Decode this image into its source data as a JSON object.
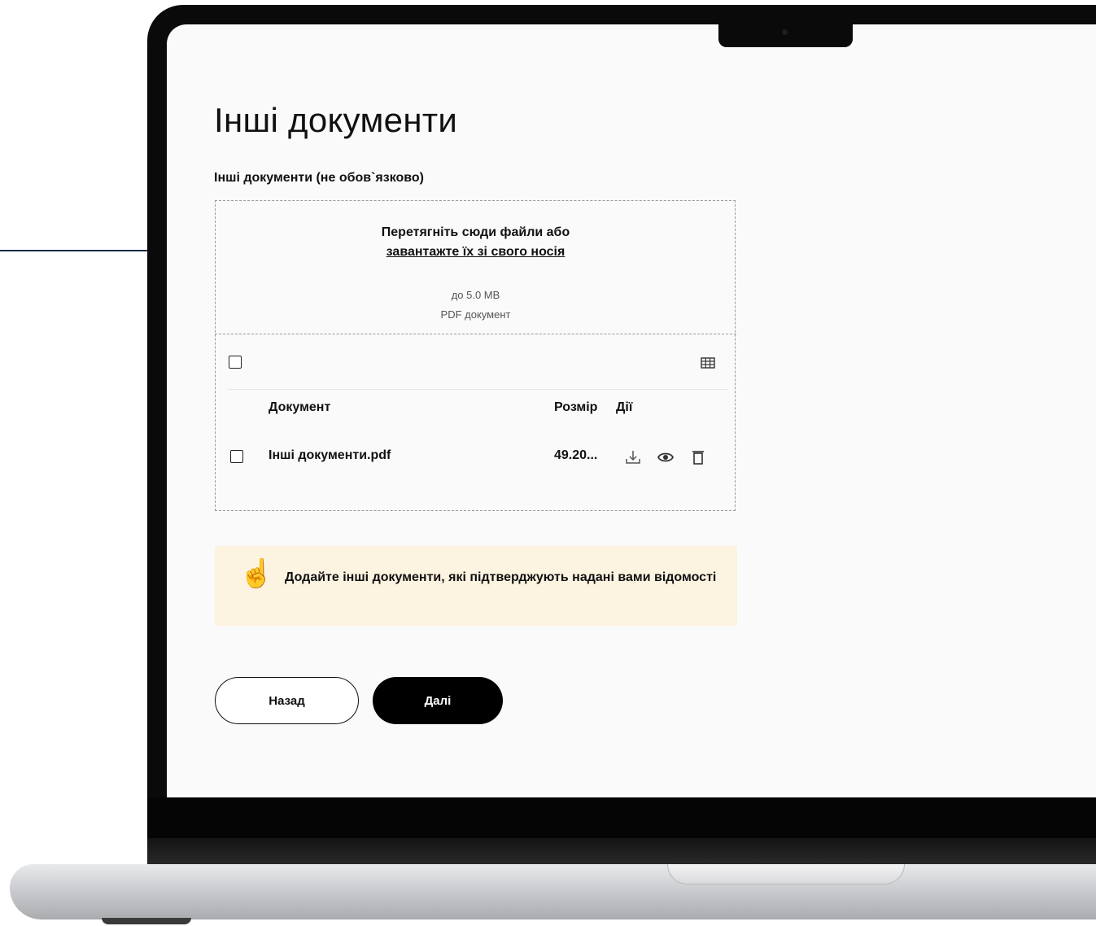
{
  "page": {
    "title": "Інші документи",
    "section_label": "Інші документи (не обов`язково)"
  },
  "dropzone": {
    "instruction": "Перетягніть сюди файли або",
    "upload_link": "завантажте їх зі свого носія",
    "size_limit": "до 5.0 MB",
    "file_type": "PDF документ"
  },
  "table": {
    "columns": {
      "document": "Документ",
      "size": "Розмір",
      "actions": "Дії"
    },
    "rows": [
      {
        "name": "Інші документи.pdf",
        "size": "49.20..."
      }
    ],
    "icons": [
      "download-icon",
      "eye-icon",
      "trash-icon",
      "grid-icon"
    ]
  },
  "hint": {
    "emoji": "☝️",
    "text": "Додайте інші документи, які підтверджують надані вами відомості"
  },
  "buttons": {
    "back": "Назад",
    "next": "Далі"
  },
  "colors": {
    "hint_background": "#fdf3e1",
    "primary_button": "#000000",
    "screen_background": "#fafafa"
  }
}
